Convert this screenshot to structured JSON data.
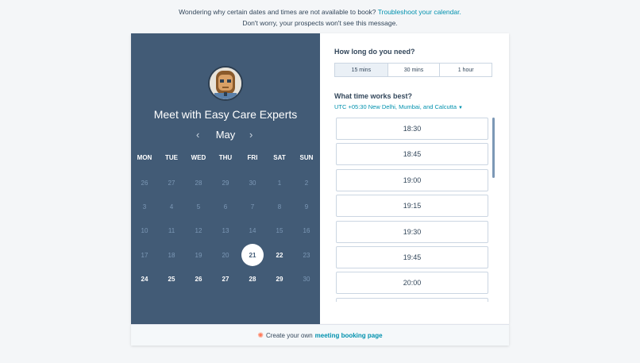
{
  "notice": {
    "line1": "Wondering why certain dates and times are not available to book?",
    "link": "Troubleshoot your calendar.",
    "line2": "Don't worry, your prospects won't see this message."
  },
  "calendar": {
    "title": "Meet with Easy Care Experts",
    "month": "May",
    "prev_icon": "chevron-left-icon",
    "next_icon": "chevron-right-icon",
    "weekdays": [
      "MON",
      "TUE",
      "WED",
      "THU",
      "FRI",
      "SAT",
      "SUN"
    ],
    "weeks": [
      [
        "26",
        "27",
        "28",
        "29",
        "30",
        "1",
        "2"
      ],
      [
        "3",
        "4",
        "5",
        "6",
        "7",
        "8",
        "9"
      ],
      [
        "10",
        "11",
        "12",
        "13",
        "14",
        "15",
        "16"
      ],
      [
        "17",
        "18",
        "19",
        "20",
        "21",
        "22",
        "23"
      ],
      [
        "24",
        "25",
        "26",
        "27",
        "28",
        "29",
        "30"
      ]
    ],
    "selected_day": "21",
    "available_days": [
      "21",
      "22",
      "24",
      "25",
      "26",
      "27",
      "28",
      "29"
    ]
  },
  "duration": {
    "question": "How long do you need?",
    "options": [
      "15 mins",
      "30 mins",
      "1 hour"
    ],
    "selected": "15 mins"
  },
  "time": {
    "question": "What time works best?",
    "timezone": "UTC +05:30 New Delhi, Mumbai, and Calcutta",
    "slots": [
      "18:30",
      "18:45",
      "19:00",
      "19:15",
      "19:30",
      "19:45",
      "20:00"
    ]
  },
  "footer": {
    "text": "Create your own",
    "link": "meeting booking page"
  },
  "colors": {
    "panel": "#425b76",
    "accent": "#0091ae",
    "brand": "#ff7a59"
  }
}
